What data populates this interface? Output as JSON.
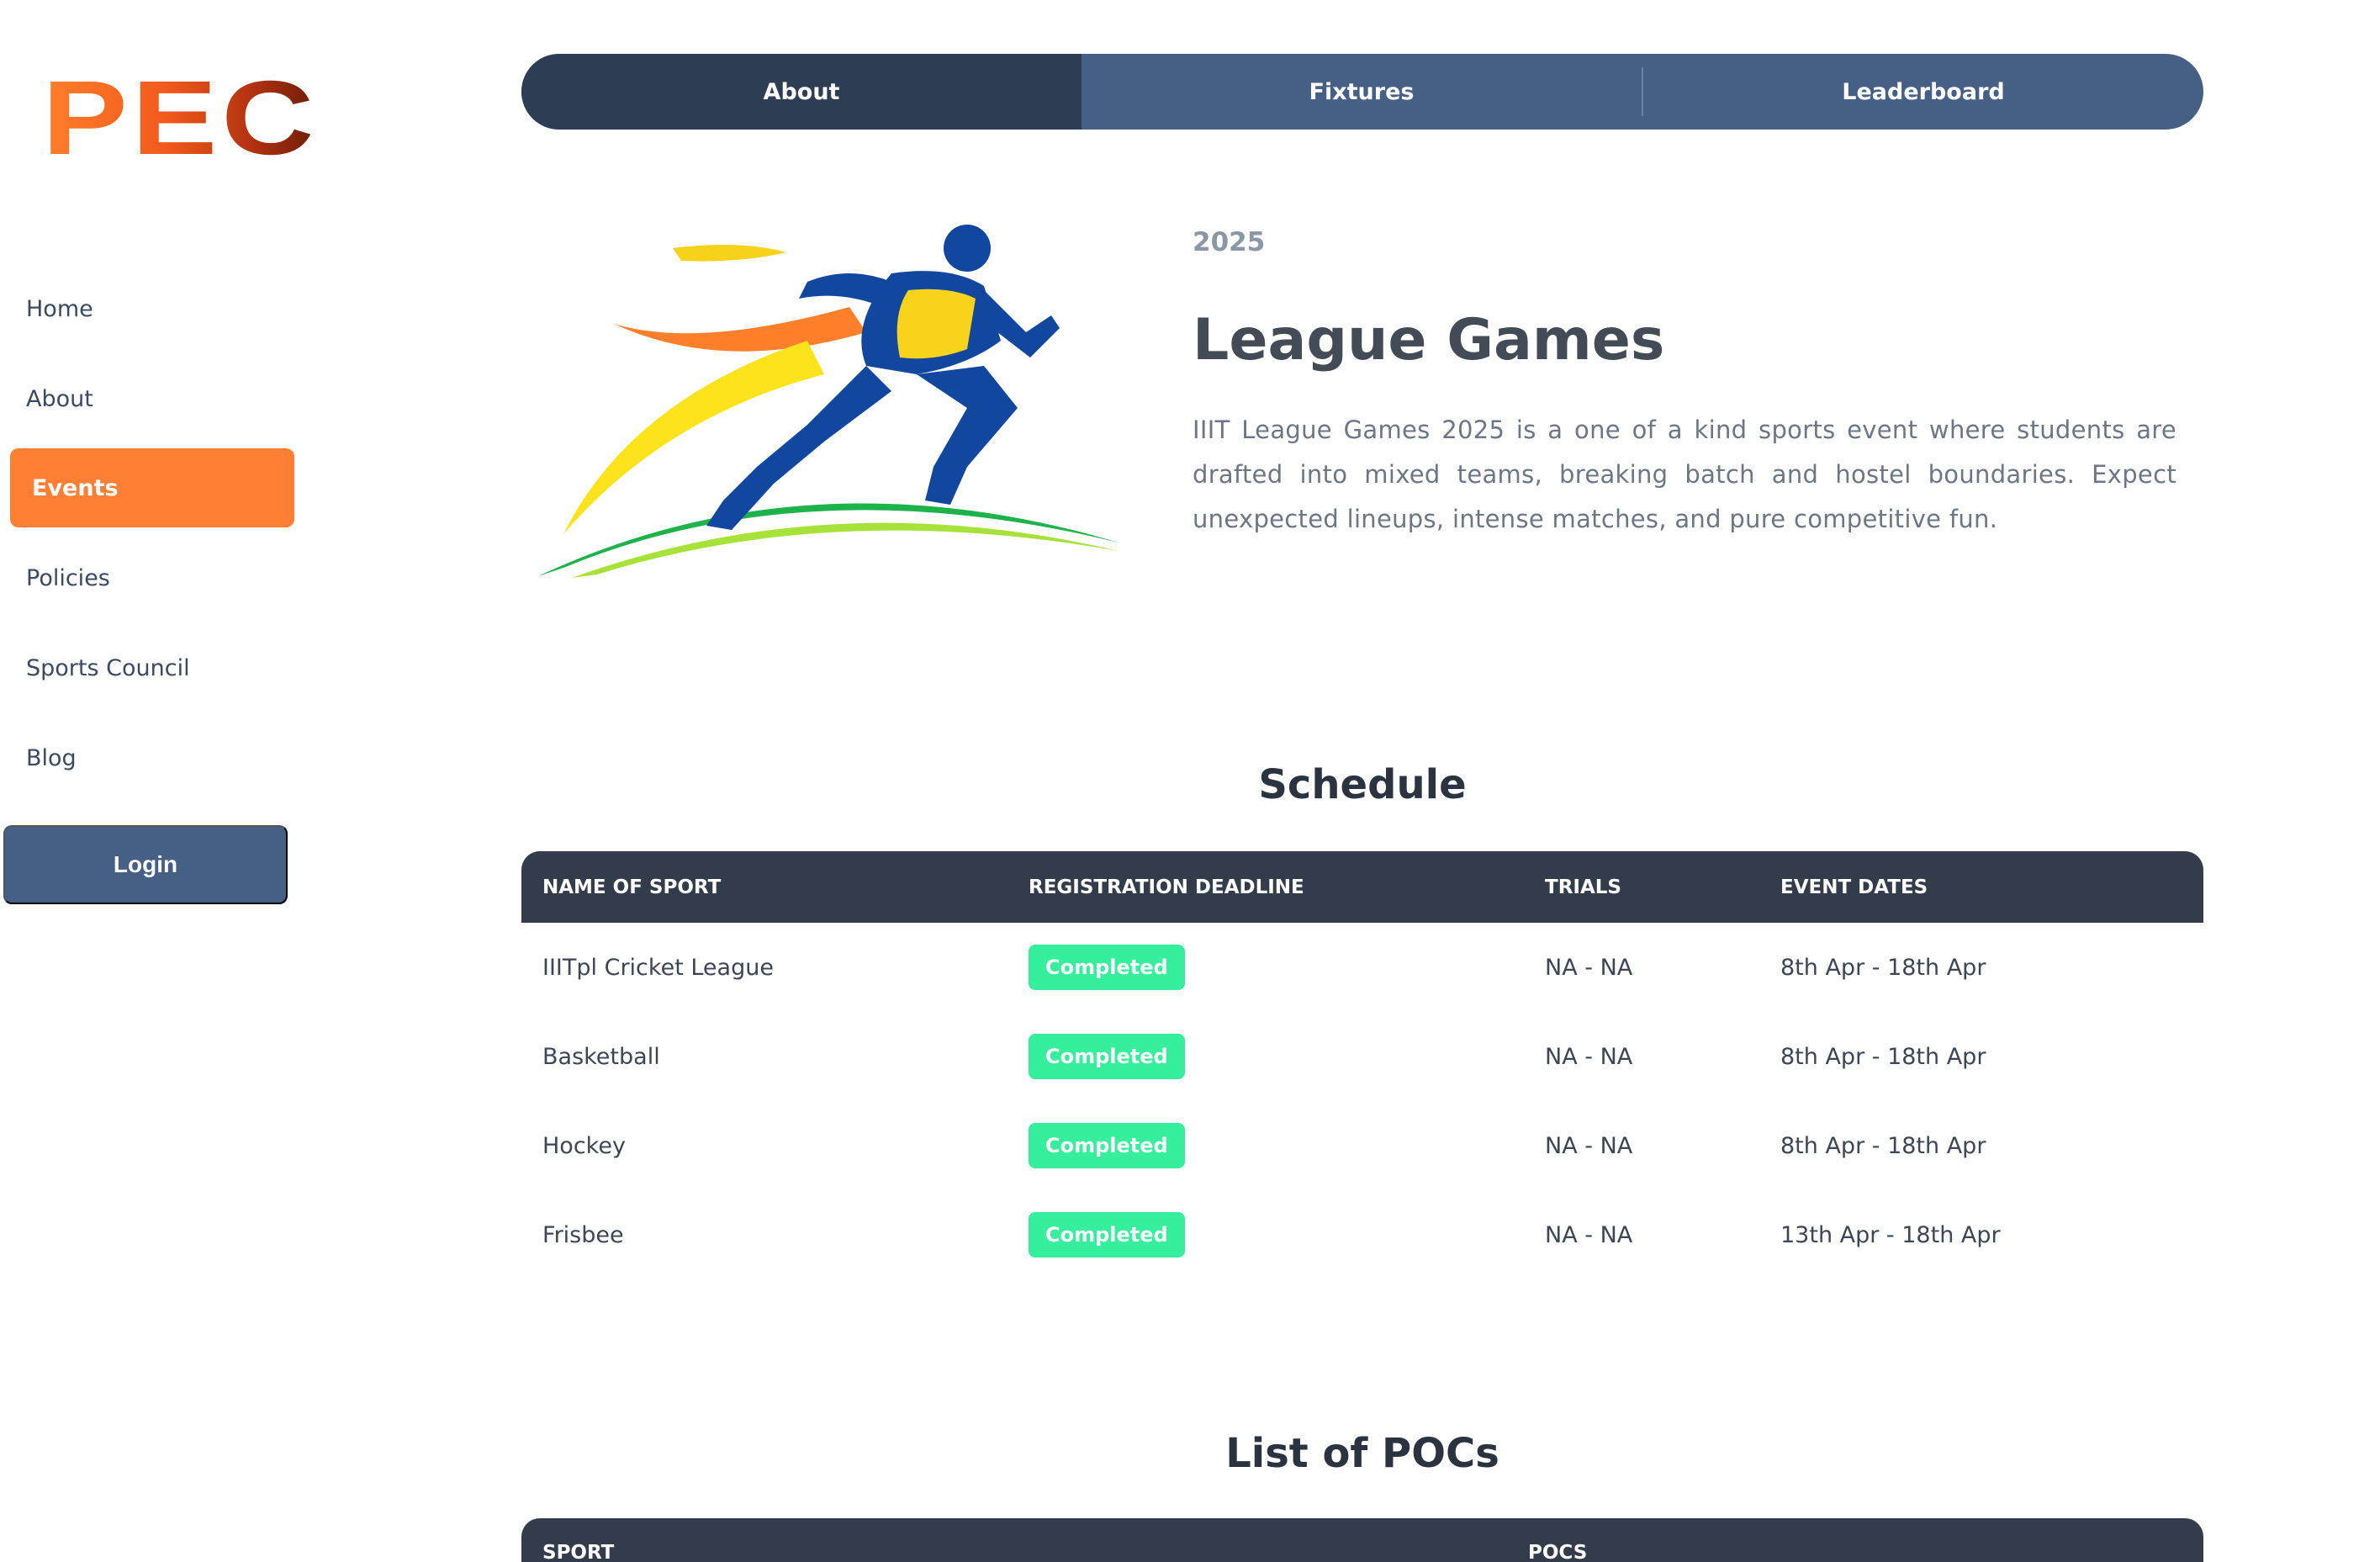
{
  "sidebar": {
    "logo": "PEC",
    "items": [
      {
        "label": "Home"
      },
      {
        "label": "About"
      },
      {
        "label": "Events"
      },
      {
        "label": "Policies"
      },
      {
        "label": "Sports Council"
      },
      {
        "label": "Blog"
      }
    ],
    "active_item": "Events",
    "login_label": "Login"
  },
  "tabs": [
    {
      "label": "About"
    },
    {
      "label": "Fixtures"
    },
    {
      "label": "Leaderboard"
    }
  ],
  "active_tab": "About",
  "event": {
    "year": "2025",
    "title": "League Games",
    "description": "IIIT League Games 2025 is a one of a kind sports event where students are drafted into mixed teams, breaking batch and hostel boundaries. Expect unexpected lineups, intense matches, and pure competitive fun."
  },
  "schedule": {
    "title": "Schedule",
    "columns": [
      "NAME OF SPORT",
      "REGISTRATION DEADLINE",
      "TRIALS",
      "EVENT DATES"
    ],
    "rows": [
      {
        "sport": "IIITpl Cricket League",
        "status": "Completed",
        "trials": "NA - NA",
        "dates": "8th Apr - 18th Apr"
      },
      {
        "sport": "Basketball",
        "status": "Completed",
        "trials": "NA - NA",
        "dates": "8th Apr - 18th Apr"
      },
      {
        "sport": "Hockey",
        "status": "Completed",
        "trials": "NA - NA",
        "dates": "8th Apr - 18th Apr"
      },
      {
        "sport": "Frisbee",
        "status": "Completed",
        "trials": "NA - NA",
        "dates": "13th Apr - 18th Apr"
      }
    ]
  },
  "pocs": {
    "title": "List of POCs",
    "columns": [
      "SPORT",
      "POCS"
    ]
  },
  "colors": {
    "accent": "#ff7f35",
    "nav_dark": "#2d3d54",
    "nav": "#465f84",
    "table_header": "#333c4a",
    "badge": "#35ef9c"
  },
  "icons": {
    "hero": "running-athlete-illustration"
  }
}
